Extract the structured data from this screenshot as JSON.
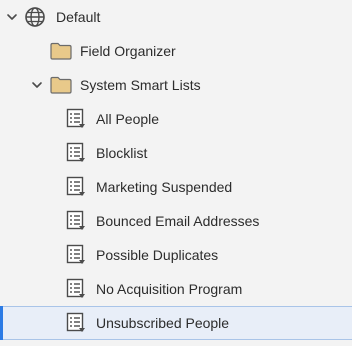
{
  "tree": {
    "root": {
      "label": "Default",
      "icon": "globe-icon",
      "expanded": true
    },
    "folders": [
      {
        "label": "Field Organizer",
        "icon": "folder-icon",
        "expanded": false
      },
      {
        "label": "System Smart Lists",
        "icon": "folder-icon",
        "expanded": true,
        "items": [
          {
            "label": "All People",
            "icon": "smart-list-icon"
          },
          {
            "label": "Blocklist",
            "icon": "smart-list-icon"
          },
          {
            "label": "Marketing Suspended",
            "icon": "smart-list-icon"
          },
          {
            "label": "Bounced Email Addresses",
            "icon": "smart-list-icon"
          },
          {
            "label": "Possible Duplicates",
            "icon": "smart-list-icon"
          },
          {
            "label": "No Acquisition Program",
            "icon": "smart-list-icon"
          },
          {
            "label": "Unsubscribed People",
            "icon": "smart-list-icon",
            "selected": true
          }
        ]
      }
    ]
  },
  "colors": {
    "background": "#f3f3f3",
    "folder_fill": "#e8c98a",
    "folder_stroke": "#6b6b6b",
    "selection_bg": "#e8eef8",
    "selection_accent": "#2c7be5"
  }
}
